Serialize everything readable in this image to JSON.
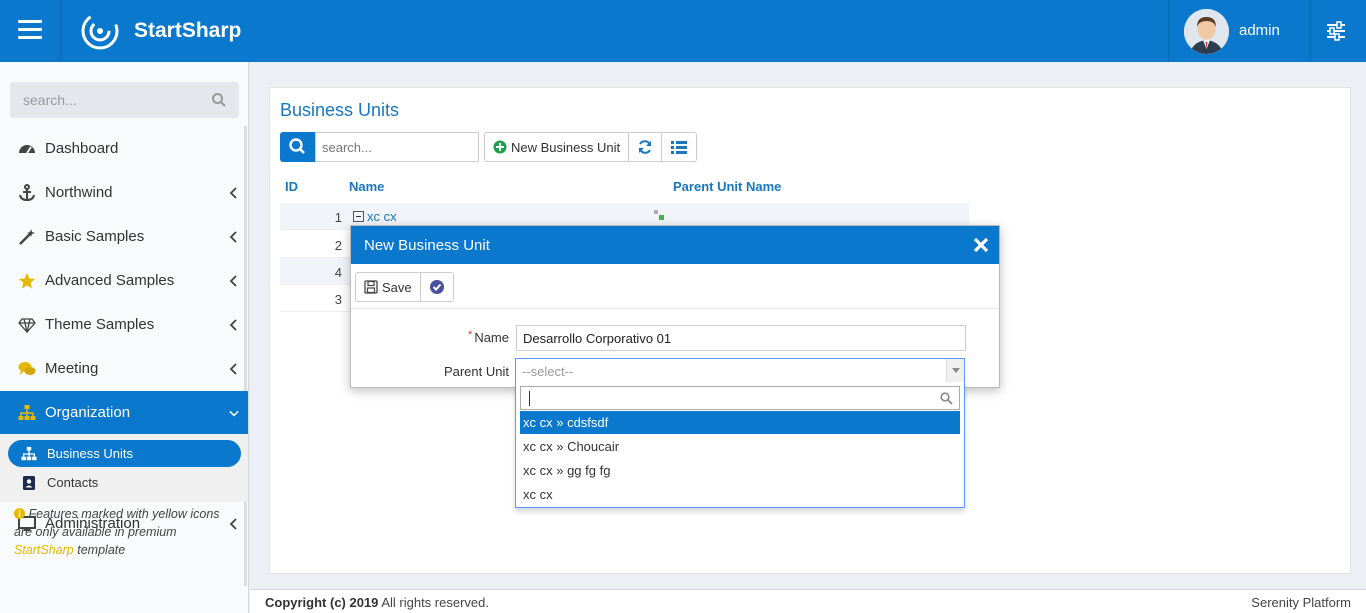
{
  "header": {
    "brand": "StartSharp",
    "username": "admin",
    "icons": [
      "menu-icon",
      "logo-icon",
      "avatar",
      "sliders-icon"
    ],
    "color": "#0a78cc"
  },
  "sidebar": {
    "search_placeholder": "search...",
    "items": [
      {
        "label": "Dashboard",
        "icon": "dashboard-icon"
      },
      {
        "label": "Northwind",
        "icon": "anchor-icon"
      },
      {
        "label": "Basic Samples",
        "icon": "magic-wand-icon"
      },
      {
        "label": "Advanced Samples",
        "icon": "star-icon"
      },
      {
        "label": "Theme Samples",
        "icon": "diamond-icon"
      },
      {
        "label": "Meeting",
        "icon": "comments-icon"
      },
      {
        "label": "Organization",
        "icon": "sitemap-icon"
      },
      {
        "label": "Administration",
        "icon": "desktop-icon"
      }
    ],
    "subitems": [
      {
        "label": "Business Units",
        "icon": "sitemap-icon"
      },
      {
        "label": "Contacts",
        "icon": "contact-book-icon"
      }
    ],
    "note_prefix": "Features marked with yellow icons are only available in premium",
    "note_brand": "StartSharp",
    "note_suffix": "template"
  },
  "page": {
    "title": "Business Units",
    "search_placeholder": "search...",
    "new_button": "New Business Unit",
    "columns": [
      "ID",
      "Name",
      "Parent Unit Name"
    ],
    "rows": [
      {
        "id": "1",
        "name": "xc cx"
      },
      {
        "id": "2",
        "name": ""
      },
      {
        "id": "4",
        "name": ""
      },
      {
        "id": "3",
        "name": ""
      }
    ]
  },
  "dialog": {
    "title": "New Business Unit",
    "save_label": "Save",
    "name_label": "Name",
    "name_value": "Desarrollo Corporativo 01",
    "parent_label": "Parent Unit",
    "parent_placeholder": "--select--",
    "options": [
      "xc cx » cdsfsdf",
      "xc cx » Choucair",
      "xc cx » gg fg fg",
      "xc cx"
    ]
  },
  "footer": {
    "copyright_bold": "Copyright (c) 2019",
    "copyright_rest": "All rights reserved.",
    "platform": "Serenity Platform"
  }
}
